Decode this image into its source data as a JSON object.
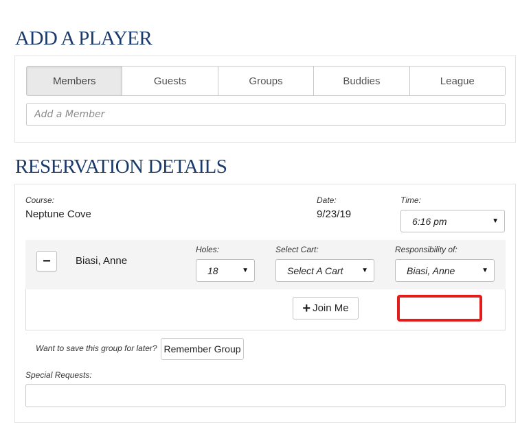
{
  "add_player": {
    "title": "ADD A PLAYER",
    "tabs": [
      {
        "label": "Members",
        "active": true
      },
      {
        "label": "Guests",
        "active": false
      },
      {
        "label": "Groups",
        "active": false
      },
      {
        "label": "Buddies",
        "active": false
      },
      {
        "label": "League",
        "active": false
      }
    ],
    "member_input": {
      "placeholder": "Add a Member",
      "value": ""
    }
  },
  "reservation": {
    "title": "RESERVATION DETAILS",
    "course_label": "Course:",
    "course_value": "Neptune Cove",
    "date_label": "Date:",
    "date_value": "9/23/19",
    "time_label": "Time:",
    "time_value": "6:16 pm",
    "player": {
      "remove_symbol": "−",
      "name": "Biasi, Anne",
      "holes_label": "Holes:",
      "holes_value": "18",
      "cart_label": "Select Cart:",
      "cart_value": "Select A Cart",
      "responsibility_label": "Responsibility of:",
      "responsibility_value": "Biasi, Anne"
    },
    "join_button": {
      "icon": "+",
      "label": "Join Me"
    },
    "save_group_prompt": "Want to save this group for later?",
    "remember_group_label": "Remember Group",
    "special_requests_label": "Special Requests:",
    "special_requests_value": ""
  },
  "colors": {
    "title": "#1a3a6b",
    "highlight_box": "#e21b1b",
    "active_tab_bg": "#e9e9e9"
  }
}
